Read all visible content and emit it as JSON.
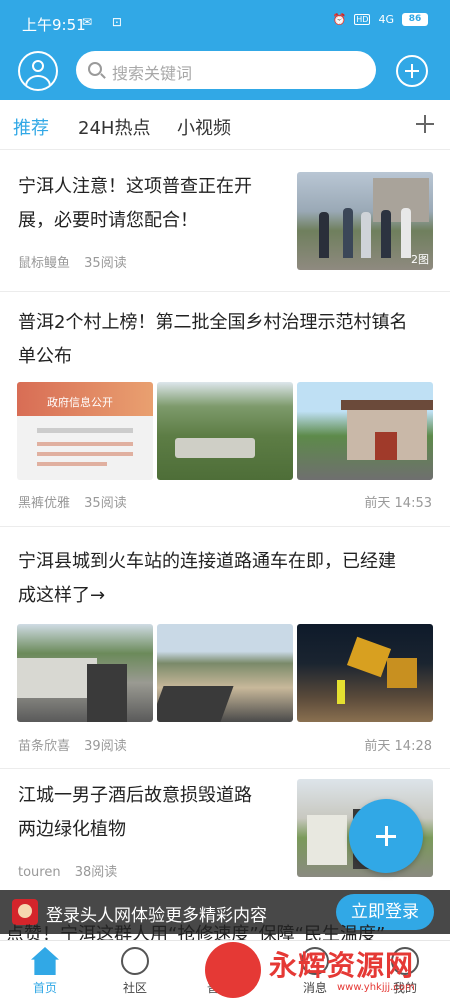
{
  "status": {
    "time": "上午9:51",
    "battery": "86",
    "network": "4G",
    "hd": "HD"
  },
  "search": {
    "placeholder": "搜索关键词"
  },
  "tabs": [
    "推荐",
    "24H热点",
    "小视频"
  ],
  "articles": [
    {
      "title_line1": "宁洱人注意！这项普查正在开",
      "title_line2": "展，必要时请您配合！",
      "author": "鼠标鳗鱼",
      "reads": "35阅读",
      "badge": "2图"
    },
    {
      "title_line1": "普洱2个村上榜！第二批全国乡村治理示范村镇名",
      "title_line2": "单公布",
      "author": "黑裤优雅",
      "reads": "35阅读",
      "time": "前天 14:53",
      "img_caption": "政府信息公开"
    },
    {
      "title_line1": "宁洱县城到火车站的连接道路通车在即，已经建",
      "title_line2": "成这样了→",
      "author": "苗条欣喜",
      "reads": "39阅读",
      "time": "前天 14:28"
    },
    {
      "title_line1": "江城一男子酒后故意损毁道路",
      "title_line2": "两边绿化植物",
      "author": "touren",
      "reads": "38阅读"
    }
  ],
  "banner": {
    "text": "登录头人网体验更多精彩内容",
    "login": "立即登录",
    "peek": "点赞！宁洱这群人用“抢修速度”保障“民生温度”"
  },
  "bottom_nav": [
    "首页",
    "社区",
    "普洱圈",
    "消息",
    "我的"
  ],
  "watermark": {
    "text": "永辉资源网",
    "url": "www.yhkjjj.com"
  },
  "colors": {
    "accent": "#31a8e6",
    "watermark": "#e53935"
  }
}
